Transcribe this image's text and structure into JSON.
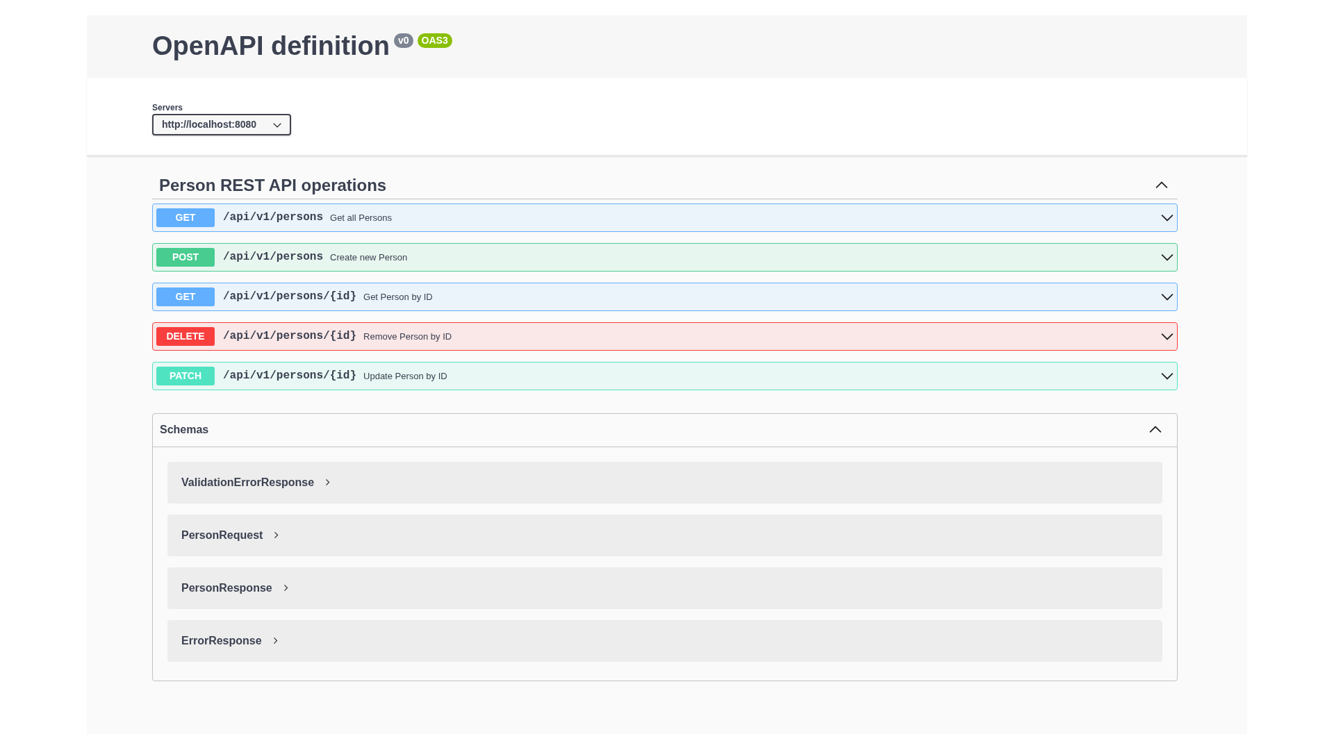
{
  "info": {
    "title": "OpenAPI definition",
    "version": "v0",
    "spec": "OAS3"
  },
  "servers": {
    "label": "Servers",
    "value": "http://localhost:8080"
  },
  "tag": {
    "name": "Person REST API operations",
    "expanded": true,
    "operations": [
      {
        "method": "GET",
        "path": "/api/v1/persons",
        "summary": "Get all Persons",
        "expanded": false
      },
      {
        "method": "POST",
        "path": "/api/v1/persons",
        "summary": "Create new Person",
        "expanded": false
      },
      {
        "method": "GET",
        "path": "/api/v1/persons/{id}",
        "summary": "Get Person by ID",
        "expanded": false
      },
      {
        "method": "DELETE",
        "path": "/api/v1/persons/{id}",
        "summary": "Remove Person by ID",
        "expanded": false
      },
      {
        "method": "PATCH",
        "path": "/api/v1/persons/{id}",
        "summary": "Update Person by ID",
        "expanded": false
      }
    ]
  },
  "schemas": {
    "title": "Schemas",
    "expanded": true,
    "items": [
      {
        "name": "ValidationErrorResponse",
        "expanded": false
      },
      {
        "name": "PersonRequest",
        "expanded": false
      },
      {
        "name": "PersonResponse",
        "expanded": false
      },
      {
        "name": "ErrorResponse",
        "expanded": false
      }
    ]
  }
}
